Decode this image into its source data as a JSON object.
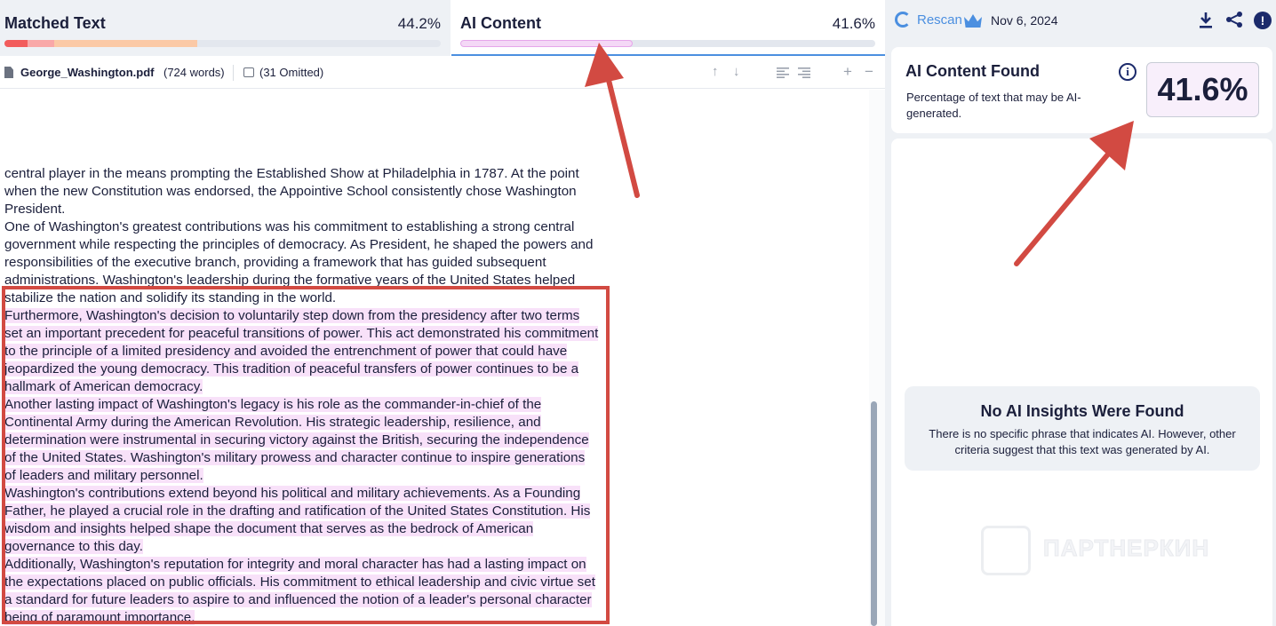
{
  "tabs": {
    "matched": {
      "label": "Matched Text",
      "percent": "44.2%"
    },
    "ai": {
      "label": "AI Content",
      "percent": "41.6%"
    }
  },
  "file": {
    "name": "George_Washington.pdf",
    "words": "(724 words)",
    "omitted": "(31 Omitted)"
  },
  "document": {
    "paragraphs_plain": [
      "central player in the means prompting the Established Show at Philadelphia in 1787. At the point when the new Constitution was endorsed, the Appointive School consistently chose Washington President.",
      "One of Washington's greatest contributions was his commitment to establishing a strong central government while respecting the principles of democracy. As President, he shaped the powers and responsibilities of the executive branch, providing a framework that has guided subsequent administrations. Washington's leadership during the formative years of the United States helped stabilize the nation and solidify its standing in the world."
    ],
    "paragraphs_highlighted": [
      "Furthermore, Washington's decision to voluntarily step down from the presidency after two terms set an important precedent for peaceful transitions of power. This act demonstrated his commitment to the principle of a limited presidency and avoided the entrenchment of power that could have jeopardized the young democracy. This tradition of peaceful transfers of power continues to be a hallmark of American democracy.",
      "Another lasting impact of Washington's legacy is his role as the commander-in-chief of the Continental Army during the American Revolution. His strategic leadership, resilience, and determination were instrumental in securing victory against the British, securing the independence of the United States. Washington's military prowess and character continue to inspire generations of leaders and military personnel.",
      "Washington's contributions extend beyond his political and military achievements. As a Founding Father, he played a crucial role in the drafting and ratification of the United States Constitution. His wisdom and insights helped shape the document that serves as the bedrock of American governance to this day.",
      "Additionally, Washington's reputation for integrity and moral character has had a lasting impact on the expectations placed on public officials. His commitment to ethical leadership and civic virtue set a standard for future leaders to aspire to and influenced the notion of a leader's personal character being of paramount importance."
    ]
  },
  "header": {
    "rescan_label": "Rescan",
    "date": "Nov 6, 2024",
    "alert_glyph": "!"
  },
  "ai_card": {
    "title": "AI Content Found",
    "description": "Percentage of text that may be AI-generated.",
    "score": "41.6%",
    "info_glyph": "i"
  },
  "insights": {
    "title": "No AI Insights Were Found",
    "description": "There is no specific phrase that indicates AI. However, other criteria suggest that this text was generated by AI."
  },
  "watermark": {
    "text": "ПАРТНЕРКИН"
  },
  "colors": {
    "accent": "#4b8fe0",
    "annotation_red": "#d24a42",
    "ai_highlight": "#f8e1f9",
    "matched_bar": [
      "#f25c5c",
      "#f9a8a8",
      "#fbc9a6"
    ]
  },
  "progress": {
    "matched_fraction": 0.442,
    "ai_fraction": 0.416
  }
}
